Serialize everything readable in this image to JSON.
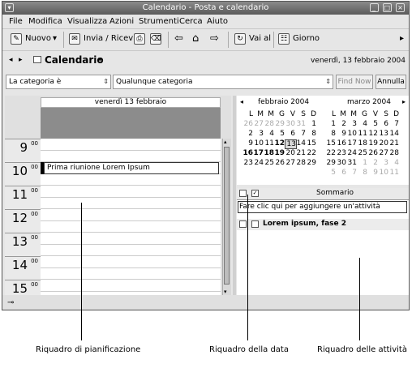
{
  "window": {
    "title": "Calendario - Posta e calendario"
  },
  "menu": [
    "File",
    "Modifica",
    "Visualizza",
    "Azioni",
    "Strumenti",
    "Cerca",
    "Aiuto"
  ],
  "toolbar": {
    "new_label": "Nuovo",
    "send_receive_label": "Invia / Ricevi",
    "goto_label": "Vai al",
    "day_label": "Giorno"
  },
  "nav": {
    "title": "Calendario",
    "date": "venerdì, 13 febbraio 2004"
  },
  "filter": {
    "category_filter": "La categoria è",
    "category_value": "Qualunque categoria",
    "find_now": "Find Now",
    "cancel": "Annulla"
  },
  "day_view": {
    "header": "venerdì 13 febbraio",
    "minutes": "00",
    "hours": [
      "9",
      "10",
      "11",
      "12",
      "13",
      "14",
      "15"
    ],
    "event": "Prima riunione Lorem Ipsum"
  },
  "date_navigator": {
    "weekdays": [
      "L",
      "M",
      "M",
      "G",
      "V",
      "S",
      "D"
    ],
    "months": [
      {
        "label": "febbraio 2004",
        "weeks": [
          [
            "26",
            "27",
            "28",
            "29",
            "30",
            "31",
            "1"
          ],
          [
            "2",
            "3",
            "4",
            "5",
            "6",
            "7",
            "8"
          ],
          [
            "9",
            "10",
            "11",
            "12",
            "13",
            "14",
            "15"
          ],
          [
            "16",
            "17",
            "18",
            "19",
            "20",
            "21",
            "22"
          ],
          [
            "23",
            "24",
            "25",
            "26",
            "27",
            "28",
            "29"
          ]
        ]
      },
      {
        "label": "marzo 2004",
        "weeks": [
          [
            "1",
            "2",
            "3",
            "4",
            "5",
            "6",
            "7"
          ],
          [
            "8",
            "9",
            "10",
            "11",
            "12",
            "13",
            "14"
          ],
          [
            "15",
            "16",
            "17",
            "18",
            "19",
            "20",
            "21"
          ],
          [
            "22",
            "23",
            "24",
            "25",
            "26",
            "27",
            "28"
          ],
          [
            "29",
            "30",
            "31",
            "1",
            "2",
            "3",
            "4"
          ],
          [
            "5",
            "6",
            "7",
            "8",
            "9",
            "10",
            "11"
          ]
        ]
      }
    ]
  },
  "tasks": {
    "summary_header": "Sommario",
    "add_placeholder": "Fare clic qui per aggiungere un'attività",
    "items": [
      "Lorem ipsum, fase 2"
    ]
  },
  "callouts": [
    "Riquadro di pianificazione",
    "Riquadro della data",
    "Riquadro delle attività"
  ]
}
